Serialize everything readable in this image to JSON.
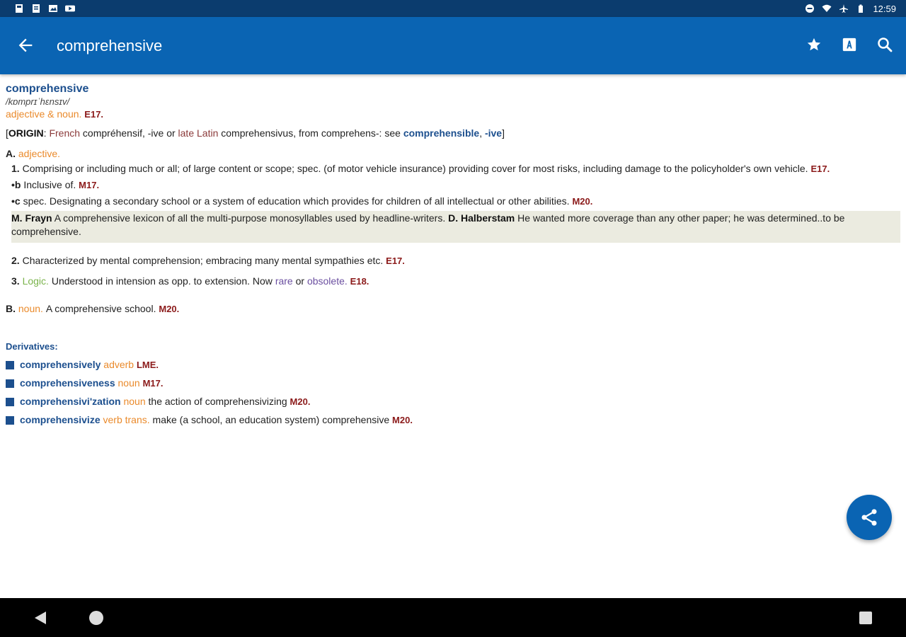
{
  "status": {
    "time": "12:59"
  },
  "appbar": {
    "title": "comprehensive"
  },
  "entry": {
    "headword": "comprehensive",
    "pronunciation": "/kɒmprɪˈhɛnsɪv/",
    "pos_line": "adjective & noun.",
    "pos_date": "E17.",
    "origin": {
      "label": "ORIGIN",
      "lang1": "French",
      "text1": "compréhensif, -ive or",
      "lang2": "late Latin",
      "text2": "comprehensivus, from comprehens-: see",
      "link1": "comprehensible",
      "link2": "-ive"
    },
    "sectionA": {
      "letter": "A.",
      "pos": "adjective.",
      "senses": [
        {
          "num": "1.",
          "text": "Comprising or including much or all; of large content or scope; spec. (of motor vehicle insurance) providing cover for most risks, including damage to the policyholder's own vehicle.",
          "date": "E17."
        },
        {
          "num": "•b",
          "text": "Inclusive of.",
          "date": "M17."
        },
        {
          "num": "•c",
          "text": "spec. Designating a secondary school or a system of education which provides for children of all intellectual or other abilities.",
          "date": "M20."
        }
      ],
      "quote": {
        "author1": "M. Frayn",
        "text1": "A comprehensive lexicon of all the multi-purpose monosyllables used by headline-writers.",
        "author2": "D. Halberstam",
        "text2": "He wanted more coverage than any other paper; he was determined..to be comprehensive."
      },
      "sense2": {
        "num": "2.",
        "text": "Characterized by mental comprehension; embracing many mental sympathies etc.",
        "date": "E17."
      },
      "sense3": {
        "num": "3.",
        "label": "Logic.",
        "text": "Understood in intension as opp. to extension. Now",
        "rare": "rare",
        "or": "or",
        "obsolete": "obsolete.",
        "date": "E18."
      }
    },
    "sectionB": {
      "letter": "B.",
      "pos": "noun.",
      "text": "A comprehensive school.",
      "date": "M20."
    },
    "derivatives": {
      "title": "Derivatives:",
      "items": [
        {
          "word": "comprehensively",
          "pos": "adverb",
          "text": "",
          "date": "LME."
        },
        {
          "word": "comprehensiveness",
          "pos": "noun",
          "text": "",
          "date": "M17."
        },
        {
          "word": "comprehensivi'zation",
          "pos": "noun",
          "text": "the action of comprehensivizing",
          "date": "M20."
        },
        {
          "word": "comprehensivize",
          "pos": "verb trans.",
          "text": "make (a school, an education system) comprehensive",
          "date": "M20."
        }
      ]
    }
  },
  "icons": {
    "back": "arrow-left-icon",
    "favorite": "star-icon",
    "font": "font-size-icon",
    "search": "search-icon",
    "share": "share-icon"
  },
  "colors": {
    "appbar": "#0a64b3",
    "statusbar": "#0b3c6e",
    "headword": "#1c4f8e",
    "pos": "#ea8a2b",
    "date": "#8b1a1a"
  }
}
